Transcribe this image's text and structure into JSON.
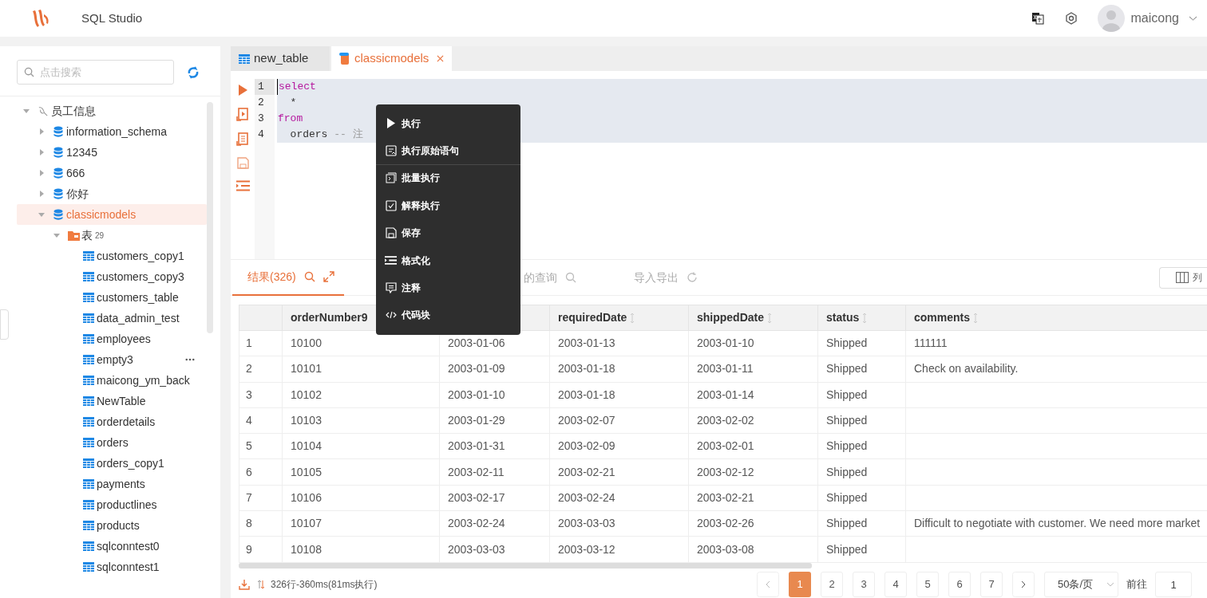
{
  "header": {
    "app_title": "SQL Studio",
    "user": "maicong"
  },
  "sidebar": {
    "search": {
      "placeholder": "点击搜索"
    },
    "tree": [
      {
        "label": "员工信息",
        "kind": "connection",
        "expanded": true,
        "selected": false,
        "children": [
          {
            "label": "information_schema",
            "kind": "database",
            "expanded": false,
            "selected": false
          },
          {
            "label": "12345",
            "kind": "database",
            "expanded": false,
            "selected": false
          },
          {
            "label": "666",
            "kind": "database",
            "expanded": false,
            "selected": false
          },
          {
            "label": "你好",
            "kind": "database",
            "expanded": false,
            "selected": false
          },
          {
            "label": "classicmodels",
            "kind": "database",
            "expanded": true,
            "selected": true,
            "children": [
              {
                "label": "表",
                "count": "29",
                "kind": "folder",
                "expanded": true,
                "selected": false,
                "children": [
                  {
                    "label": "customers_copy1",
                    "kind": "table",
                    "selected": false
                  },
                  {
                    "label": "customers_copy3",
                    "kind": "table",
                    "selected": false
                  },
                  {
                    "label": "customers_table",
                    "kind": "table",
                    "selected": false
                  },
                  {
                    "label": "data_admin_test",
                    "kind": "table",
                    "selected": false
                  },
                  {
                    "label": "employees",
                    "kind": "table",
                    "selected": false
                  },
                  {
                    "label": "empty3",
                    "kind": "table",
                    "selected": false,
                    "hovered": true
                  },
                  {
                    "label": "maicong_ym_back",
                    "kind": "table",
                    "selected": false
                  },
                  {
                    "label": "NewTable",
                    "kind": "table",
                    "selected": false
                  },
                  {
                    "label": "orderdetails",
                    "kind": "table",
                    "selected": false
                  },
                  {
                    "label": "orders",
                    "kind": "table",
                    "selected": false
                  },
                  {
                    "label": "orders_copy1",
                    "kind": "table",
                    "selected": false
                  },
                  {
                    "label": "payments",
                    "kind": "table",
                    "selected": false
                  },
                  {
                    "label": "productlines",
                    "kind": "table",
                    "selected": false
                  },
                  {
                    "label": "products",
                    "kind": "table",
                    "selected": false
                  },
                  {
                    "label": "sqlconntest0",
                    "kind": "table",
                    "selected": false
                  },
                  {
                    "label": "sqlconntest1",
                    "kind": "table",
                    "selected": false
                  }
                ]
              }
            ]
          }
        ]
      }
    ]
  },
  "editor_tabs": [
    {
      "label": "new_table",
      "kind": "table",
      "selected": false,
      "closable": false
    },
    {
      "label": "classicmodels",
      "kind": "query",
      "selected": true,
      "closable": true
    }
  ],
  "editor": {
    "lines": [
      {
        "number": "1",
        "current": true,
        "tokens": [
          {
            "kind": "keyword",
            "text": "select"
          }
        ]
      },
      {
        "number": "2",
        "current": false,
        "tokens": [
          {
            "kind": "plain",
            "text": "  *"
          }
        ]
      },
      {
        "number": "3",
        "current": false,
        "tokens": [
          {
            "kind": "keyword",
            "text": "from"
          }
        ]
      },
      {
        "number": "4",
        "current": false,
        "tokens": [
          {
            "kind": "plain",
            "text": "  orders "
          },
          {
            "kind": "comment",
            "text": "-- 注"
          }
        ]
      }
    ]
  },
  "context_menu": {
    "items": [
      {
        "label": "执行",
        "kind": "run",
        "divider_after": false
      },
      {
        "label": "执行原始语句",
        "kind": "raw",
        "divider_after": true
      },
      {
        "label": "批量执行",
        "kind": "batch",
        "divider_after": false
      },
      {
        "label": "解释执行",
        "kind": "explain",
        "divider_after": false
      },
      {
        "label": "保存",
        "kind": "save",
        "divider_after": false
      },
      {
        "label": "格式化",
        "kind": "format",
        "divider_after": false
      },
      {
        "label": "注释",
        "kind": "comment",
        "divider_after": false
      },
      {
        "label": "代码块",
        "kind": "snippet",
        "divider_after": false
      }
    ]
  },
  "results_tabs": [
    {
      "label": "结果(326)",
      "selected": true,
      "kind": "results"
    },
    {
      "label": "的查询",
      "selected": false,
      "kind": "saved"
    },
    {
      "label": "导入导出",
      "selected": false,
      "kind": "io"
    }
  ],
  "columns_button": "列",
  "table": {
    "columns": [
      {
        "label": "orderNumber9"
      },
      {},
      {
        "label": "requiredDate",
        "sort_icon": true
      },
      {
        "label": "shippedDate",
        "sort_icon": true
      },
      {
        "label": "status",
        "sort_icon": true
      },
      {
        "label": "comments",
        "sort_icon": true
      }
    ],
    "rows": [
      {
        "index": "1",
        "cells": [
          "10100",
          "2003-01-06",
          "2003-01-13",
          "2003-01-10",
          "Shipped",
          "111111"
        ]
      },
      {
        "index": "2",
        "cells": [
          "10101",
          "2003-01-09",
          "2003-01-18",
          "2003-01-11",
          "Shipped",
          "Check on availability."
        ]
      },
      {
        "index": "3",
        "cells": [
          "10102",
          "2003-01-10",
          "2003-01-18",
          "2003-01-14",
          "Shipped",
          null
        ]
      },
      {
        "index": "4",
        "cells": [
          "10103",
          "2003-01-29",
          "2003-02-07",
          "2003-02-02",
          "Shipped",
          null
        ]
      },
      {
        "index": "5",
        "cells": [
          "10104",
          "2003-01-31",
          "2003-02-09",
          "2003-02-01",
          "Shipped",
          null
        ]
      },
      {
        "index": "6",
        "cells": [
          "10105",
          "2003-02-11",
          "2003-02-21",
          "2003-02-12",
          "Shipped",
          null
        ]
      },
      {
        "index": "7",
        "cells": [
          "10106",
          "2003-02-17",
          "2003-02-24",
          "2003-02-21",
          "Shipped",
          null
        ]
      },
      {
        "index": "8",
        "cells": [
          "10107",
          "2003-02-24",
          "2003-03-03",
          "2003-02-26",
          "Shipped",
          "Difficult to negotiate with customer. We need more market"
        ]
      },
      {
        "index": "9",
        "cells": [
          "10108",
          "2003-03-03",
          "2003-03-12",
          "2003-03-08",
          "Shipped",
          null
        ]
      }
    ]
  },
  "footer": {
    "summary": "326行-360ms(81ms执行)",
    "pages": [
      {
        "label": "1",
        "selected": true
      },
      {
        "label": "2",
        "selected": false
      },
      {
        "label": "3",
        "selected": false
      },
      {
        "label": "4",
        "selected": false
      },
      {
        "label": "5",
        "selected": false
      },
      {
        "label": "6",
        "selected": false
      },
      {
        "label": "7",
        "selected": false
      }
    ],
    "page_size": "50条/页",
    "goto_label": "前往",
    "goto_value": "1"
  }
}
